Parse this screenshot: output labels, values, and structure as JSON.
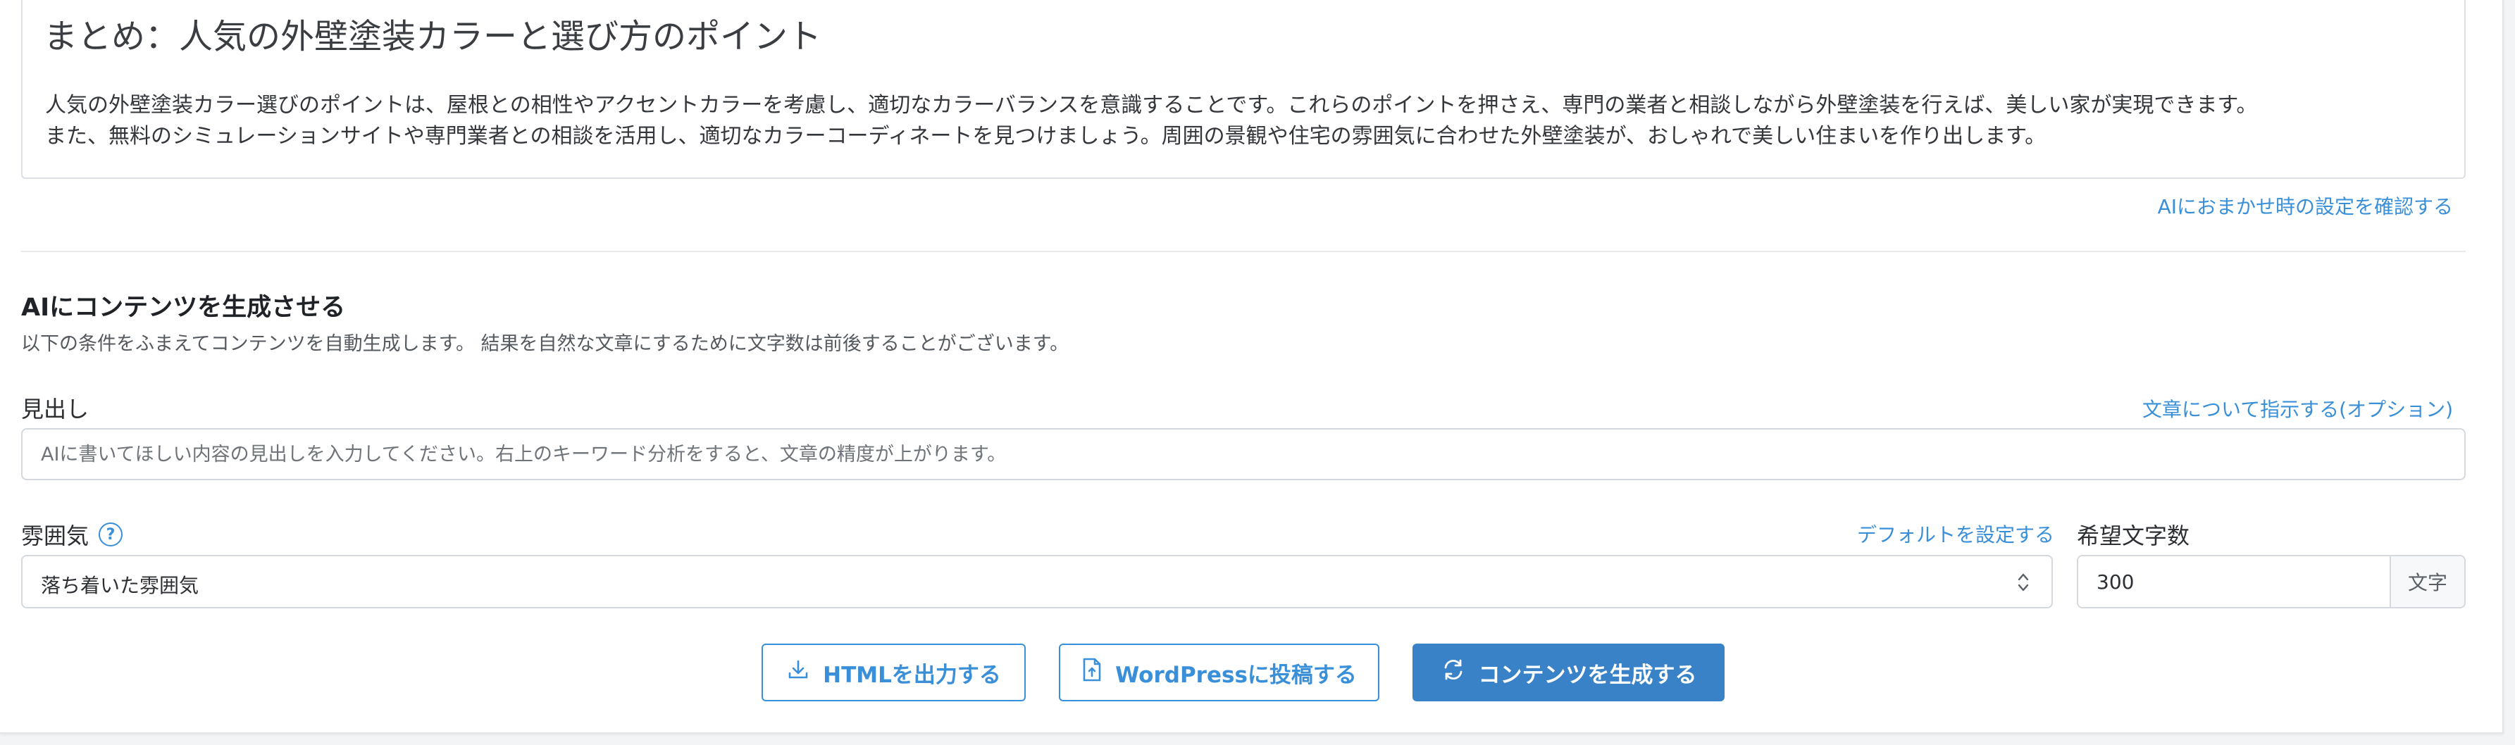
{
  "summary": {
    "title": "まとめ：人気の外壁塗装カラーと選び方のポイント",
    "lines": [
      "人気の外壁塗装カラー選びのポイントは、屋根との相性やアクセントカラーを考慮し、適切なカラーバランスを意識することです。これらのポイントを押さえ、専門の業者と相談しながら外壁塗装を行えば、美しい家が実現できます。",
      "また、無料のシミュレーションサイトや専門業者との相談を活用し、適切なカラーコーディネートを見つけましょう。周囲の景観や住宅の雰囲気に合わせた外壁塗装が、おしゃれで美しい住まいを作り出します。"
    ],
    "ai_settings_link": "AIにおまかせ時の設定を確認する"
  },
  "generate": {
    "title": "AIにコンテンツを生成させる",
    "description": "以下の条件をふまえてコンテンツを自動生成します。 結果を自然な文章にするために文字数は前後することがございます。",
    "heading_label": "見出し",
    "instruction_link": "文章について指示する(オプション)",
    "heading_placeholder": "AIに書いてほしい内容の見出しを入力してください。右上のキーワード分析をすると、文章の精度が上がります。",
    "mood_label": "雰囲気",
    "help_icon_glyph": "?",
    "default_link": "デフォルトを設定する",
    "mood_value": "落ち着いた雰囲気",
    "char_count_label": "希望文字数",
    "char_count_value": "300",
    "char_count_unit": "文字"
  },
  "buttons": {
    "html_export": "HTMLを出力する",
    "wordpress_post": "WordPressに投稿する",
    "generate_content": "コンテンツを生成する"
  },
  "colors": {
    "accent": "#3a8fd9",
    "primary_button": "#3a82c8",
    "border": "#d5d9de"
  },
  "icons": {
    "help": "question-circle-icon",
    "select": "chevron-up-down-icon",
    "html_export": "download-icon",
    "wordpress_post": "file-upload-icon",
    "generate_content": "refresh-icon"
  }
}
